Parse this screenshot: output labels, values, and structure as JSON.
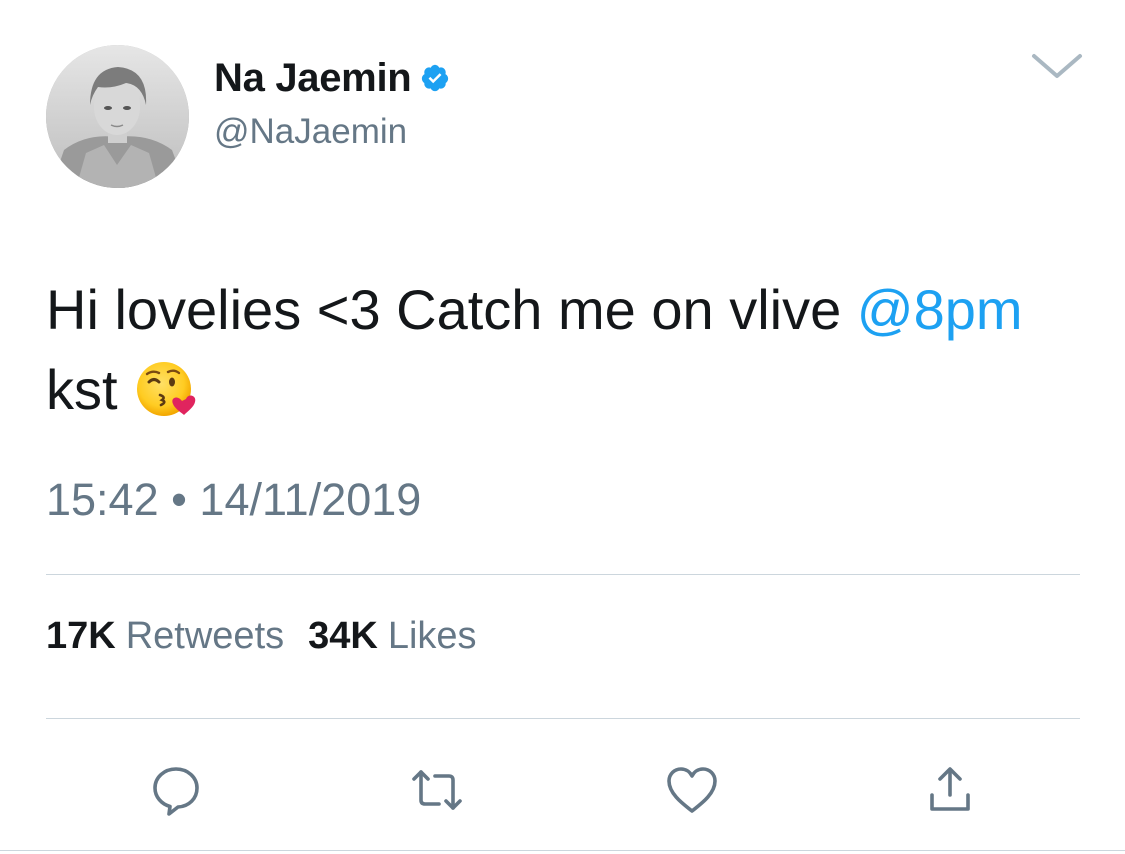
{
  "tweet": {
    "author": {
      "display_name": "Na Jaemin",
      "handle": "@NaJaemin",
      "verified": true
    },
    "text_before_mention": "Hi lovelies <3 Catch me on vlive ",
    "mention": "@8pm",
    "text_after_mention": " kst",
    "emoji": "face-blowing-a-kiss",
    "time": "15:42",
    "separator": "•",
    "date": "14/11/2019",
    "retweets_count": "17K",
    "retweets_label": "Retweets",
    "likes_count": "34K",
    "likes_label": "Likes"
  },
  "icons": {
    "verified": "verified-badge-icon",
    "menu": "chevron-down-icon",
    "reply": "reply-icon",
    "retweet": "retweet-icon",
    "like": "heart-icon",
    "share": "share-icon"
  },
  "colors": {
    "text_primary": "#14171a",
    "text_secondary": "#657786",
    "accent": "#1da1f2",
    "divider": "#ccd6dd",
    "icon_gray": "#657786"
  }
}
